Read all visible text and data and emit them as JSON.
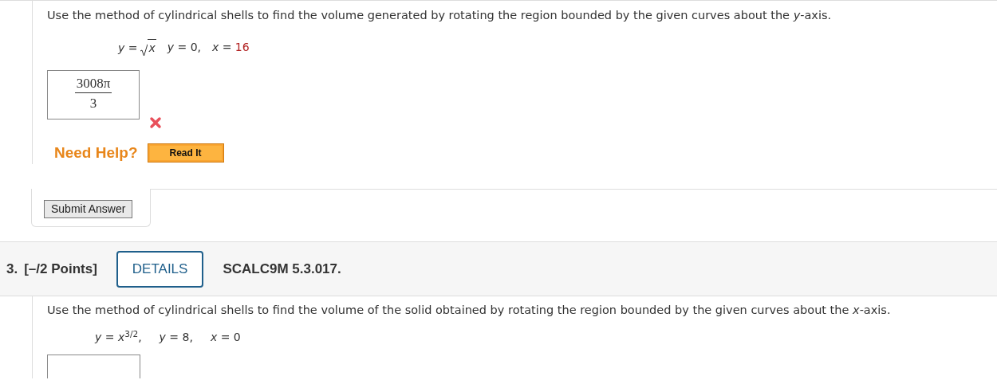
{
  "question_2": {
    "prompt": "Use the method of cylindrical shells to find the volume generated by rotating the region bounded by the given curves about the *y*-axis.",
    "equation": [
      {
        "kind": "sqrt",
        "text": "*y* =",
        "radicand": "*x*"
      },
      {
        "kind": "text",
        "text": "*y* = 0,"
      },
      {
        "kind": "text",
        "text": "*x* =",
        "value": "16",
        "color": "#b22222"
      }
    ],
    "answer": {
      "numerator": "3008π",
      "denominator": "3",
      "correct": false
    },
    "help": {
      "label": "Need Help?",
      "button": "Read It"
    },
    "submit_button": "Submit Answer"
  },
  "question_3": {
    "number": "3.",
    "points": "[–/2 Points]",
    "details_button": "DETAILS",
    "code": "SCALC9M 5.3.017.",
    "prompt": "Use the method of cylindrical shells to find the volume of the solid obtained by rotating the region bounded by the given curves about the *x*-axis.",
    "equation": [
      {
        "kind": "text",
        "text": "*y* = *x*$^{3/2}$,"
      },
      {
        "kind": "text",
        "text": "*y* = 8,"
      },
      {
        "kind": "text",
        "text": "*x* = 0"
      }
    ]
  }
}
